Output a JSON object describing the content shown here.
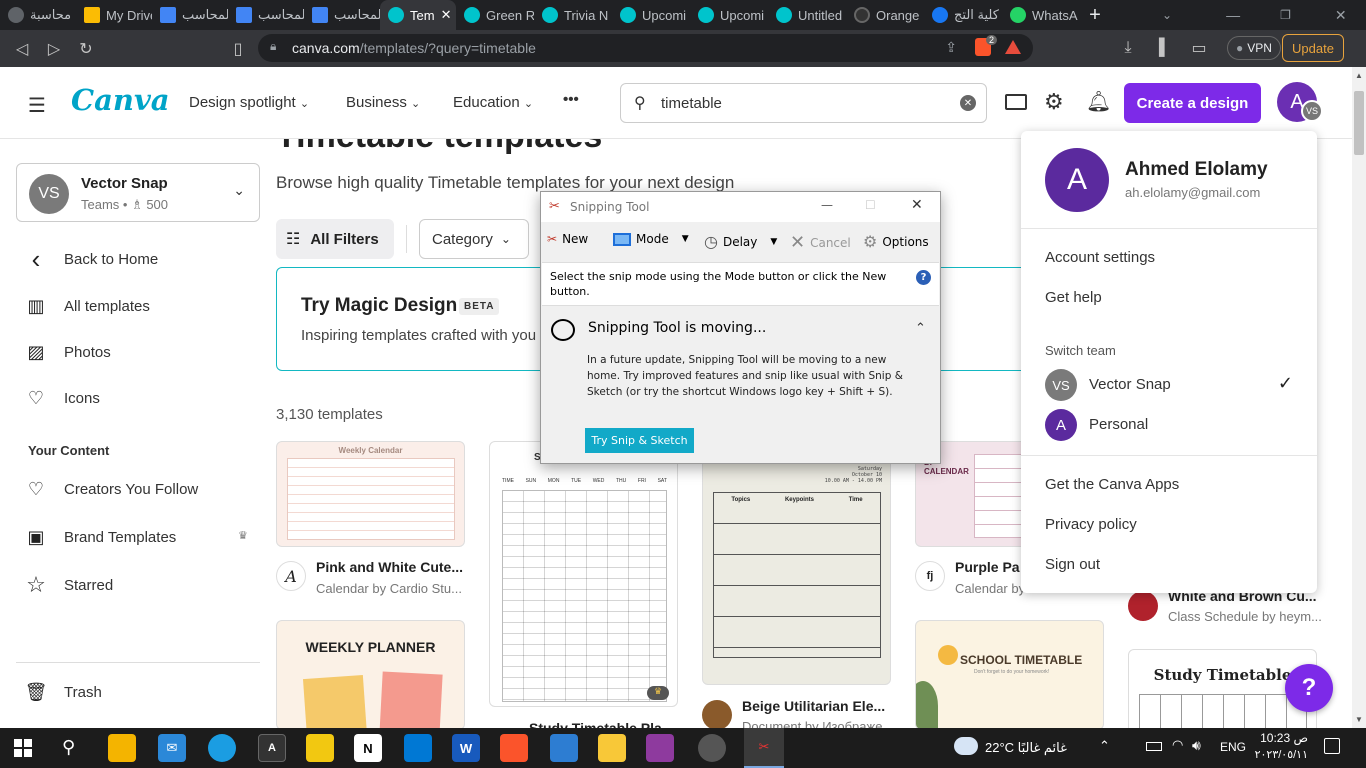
{
  "browser": {
    "tabs": [
      {
        "label": "محاسبة",
        "color": "#5f6368"
      },
      {
        "label": "My Drive",
        "color": "#fbbc04"
      },
      {
        "label": "المحاسب",
        "color": "#4285f4"
      },
      {
        "label": "المحاسب",
        "color": "#4285f4"
      },
      {
        "label": "المحاسب",
        "color": "#4285f4"
      },
      {
        "label": "Tem",
        "color": "#00c4cc"
      },
      {
        "label": "Green R",
        "color": "#00c4cc"
      },
      {
        "label": "Trivia N",
        "color": "#00c4cc"
      },
      {
        "label": "Upcomi",
        "color": "#00c4cc"
      },
      {
        "label": "Upcomi",
        "color": "#00c4cc"
      },
      {
        "label": "Untitled",
        "color": "#00c4cc"
      },
      {
        "label": "Orange",
        "color": "#333333"
      },
      {
        "label": "كلية التج",
        "color": "#1877f2"
      },
      {
        "label": "WhatsA",
        "color": "#25d366"
      }
    ],
    "url_host": "canva.com",
    "url_path": "/templates/?query=timetable",
    "vpn_label": "VPN",
    "update_label": "Update",
    "brave_badge": "2"
  },
  "header": {
    "logo": "Canva",
    "nav": [
      "Design spotlight",
      "Business",
      "Education"
    ],
    "more": "•••",
    "search_value": "timetable",
    "create_label": "Create a design",
    "avatar_letter": "A",
    "avatar_badge": "VS"
  },
  "sidebar": {
    "team": {
      "initials": "VS",
      "name": "Vector Snap",
      "sub": "Teams • ♗ 500"
    },
    "items": [
      {
        "label": "Back to Home",
        "icon": "‹"
      },
      {
        "label": "All templates",
        "icon": "▥"
      },
      {
        "label": "Photos",
        "icon": "▨"
      },
      {
        "label": "Icons",
        "icon": "♡"
      }
    ],
    "section": "Your Content",
    "content_items": [
      {
        "label": "Creators You Follow",
        "icon": "♡"
      },
      {
        "label": "Brand Templates",
        "icon": "▣"
      },
      {
        "label": "Starred",
        "icon": "☆"
      }
    ],
    "trash": "Trash"
  },
  "main": {
    "title": "Timetable templates",
    "subtitle": "Browse high quality Timetable templates for your next design",
    "all_filters": "All Filters",
    "category": "Category",
    "magic_title": "Try Magic Design",
    "magic_badge": "BETA",
    "magic_sub": "Inspiring templates crafted with you",
    "count": "3,130 templates",
    "cards": [
      {
        "title": "Pink and White Cute...",
        "sub": "Calendar by Cardio Stu..."
      },
      {
        "title": "Study Timetable Pla",
        "sub": ""
      },
      {
        "title": "Beige Utilitarian Ele...",
        "sub": "Document by Изображе..."
      },
      {
        "title": "Purple Pa",
        "sub": "Calendar by"
      },
      {
        "title": "White and Brown Cu...",
        "sub": "Class Schedule by heym..."
      }
    ],
    "thumb_texts": {
      "weekly_calendar": "Weekly Calendar",
      "weekly_planner": "WEEKLY PLANNER",
      "school_timetable": "SCHOOL TIMETABLE",
      "school_sub": "Don't forget to do your homework!",
      "study_timetable": "Study Timetable",
      "beige_head": "Saturday\nOctober 10\n10.00 AM - 14.00 PM",
      "beige_col1": "Topics",
      "beige_col2": "Keypoints",
      "beige_col3": "Time",
      "purple_title": "LY CALENDAR",
      "days": [
        "TIME",
        "SUN",
        "MON",
        "TUE",
        "WED",
        "THU",
        "FRI",
        "SAT"
      ]
    }
  },
  "profile_menu": {
    "name": "Ahmed Elolamy",
    "email": "ah.elolamy@gmail.com",
    "letter": "A",
    "items": [
      "Account settings",
      "Get help"
    ],
    "switch_team": "Switch team",
    "teams": [
      {
        "initials": "VS",
        "name": "Vector Snap",
        "checked": "✓"
      },
      {
        "initials": "A",
        "name": "Personal"
      }
    ],
    "footer_items": [
      "Get the Canva Apps",
      "Privacy policy",
      "Sign out"
    ]
  },
  "snipping_tool": {
    "title": "Snipping Tool",
    "buttons": {
      "new": "New",
      "mode": "Mode",
      "delay": "Delay",
      "cancel": "Cancel",
      "options": "Options"
    },
    "hint": "Select the snip mode using the Mode button or click the New button.",
    "moving_title": "Snipping Tool is moving...",
    "moving_body": "In a future update, Snipping Tool will be moving to a new home. Try improved features and snip like usual with Snip & Sketch (or try the shortcut Windows logo key + Shift + S).",
    "try_btn": "Try Snip & Sketch"
  },
  "help_button": "?",
  "taskbar": {
    "weather": "22°C  غائم غالبًا",
    "lang": "ENG",
    "time": "10:23 ص",
    "date": "٢٠٢٣/٠٥/١١"
  }
}
